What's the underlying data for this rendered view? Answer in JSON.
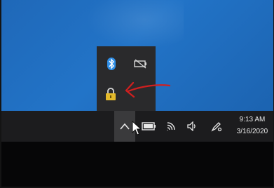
{
  "tray": {
    "flyout_icons": [
      "bluetooth-icon",
      "battery-unplugged-icon",
      "vpn-lock-icon"
    ],
    "taskbar_icons": [
      "show-hidden-icons-chevron-icon",
      "battery-icon",
      "wifi-icon",
      "volume-icon",
      "pen-workspace-icon"
    ],
    "annotation": "red-arrow-pointing-to-lock-icon"
  },
  "clock": {
    "time": "9:13 AM",
    "date": "3/16/2020"
  },
  "colors": {
    "desktop": "#1f68b8",
    "flyout": "#2a2a2c",
    "taskbar": "#1c1c1e",
    "bluetooth": "#2f8fe8",
    "lock": "#e3b92b",
    "arrow": "#d11f1f"
  }
}
